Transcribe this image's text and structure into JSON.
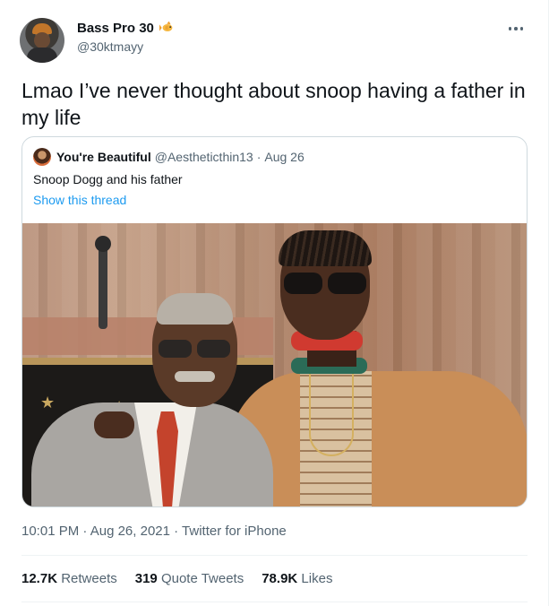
{
  "author": {
    "display_name": "Bass Pro 30",
    "handle": "@30ktmayy",
    "badge_icon": "fish-emoji-icon",
    "avatar_icon": "avatar-icon"
  },
  "more_icon": "more-dots-icon",
  "tweet": {
    "text": "Lmao I’ve never thought about snoop having a father in my life"
  },
  "quoted_tweet": {
    "display_name": "You're Beautiful",
    "handle": "@Aestheticthin13",
    "separator": "·",
    "date": "Aug 26",
    "text": "Snoop Dogg and his father",
    "show_thread": "Show this thread",
    "image_icon": "photo-two-men-image"
  },
  "meta": {
    "time": "10:01 PM",
    "separator1": " · ",
    "date": "Aug 26, 2021",
    "separator2": " · ",
    "source": "Twitter for iPhone"
  },
  "stats": {
    "retweets_count": "12.7K",
    "retweets_label": "Retweets",
    "quotes_count": "319",
    "quotes_label": "Quote Tweets",
    "likes_count": "78.9K",
    "likes_label": "Likes"
  },
  "colors": {
    "text_primary": "#0f1419",
    "text_secondary": "#536471",
    "link": "#1d9bf0",
    "border": "#cfd9de"
  }
}
